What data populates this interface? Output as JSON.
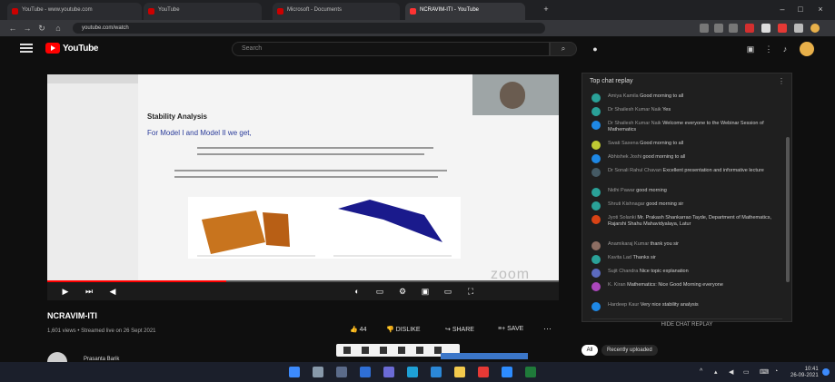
{
  "browser": {
    "tabs": [
      {
        "label": "YouTube - www.youtube.com"
      },
      {
        "label": "YouTube"
      },
      {
        "label": "Microsoft - Documents"
      },
      {
        "label": "NCRAVIM-ITI - YouTube",
        "active": true
      }
    ],
    "url": "youtube.com/watch"
  },
  "youtube": {
    "logo_text": "YouTube",
    "search_placeholder": "Search"
  },
  "video": {
    "slide_title": "Stability Analysis",
    "slide_subtitle": "For Model I and Model II we get,",
    "watermark": "zoom",
    "progress": 0.35,
    "title": "NCRAVIM-ITI",
    "meta": "1,601 views • Streamed live on 26 Sept 2021",
    "likes": "44",
    "dislike_label": "DISLIKE",
    "share_label": "SHARE",
    "save_label": "SAVE",
    "channel_name": "Prasanta Barik"
  },
  "chat": {
    "header": "Top chat replay",
    "messages": [
      {
        "author": "Amiya Kamila",
        "text": "Good morning to all",
        "color": "#2aa198"
      },
      {
        "author": "Dr Shailesh Kumar Naik",
        "text": "Yes",
        "color": "#2aa198"
      },
      {
        "author": "Dr Shailesh Kumar Naik",
        "text": "Welcome everyone to the Webinar Session of Mathematics",
        "color": "#1e88e5"
      },
      {
        "author": "Swati Saxena",
        "text": "Good morning to all",
        "color": "#c0ca33"
      },
      {
        "author": "Abhishek Joshi",
        "text": "good morning to all",
        "color": "#1e88e5"
      },
      {
        "author": "Dr Sonali Rahul Chavan",
        "text": "Excellent presentation and informative lecture",
        "color": "#455a64"
      },
      {
        "author": "Nidhi Pawar",
        "text": "good morning",
        "color": "#2aa198"
      },
      {
        "author": "Shruti Kishnagar",
        "text": "good morning sir",
        "color": "#2aa198"
      },
      {
        "author": "Jyoti Solanki",
        "text": "Mr. Prakash Shankarrao Tayde, Department of Mathematics, Rajarshi Shahu Mahavidyalaya, Latur",
        "color": "#d84315"
      },
      {
        "author": "Anamikaraj Kumar",
        "text": "thank you sir",
        "color": "#8d6e63"
      },
      {
        "author": "Kavita Lad",
        "text": "Thanks sir",
        "color": "#2aa198"
      },
      {
        "author": "Sujit Chandra",
        "text": "Nice topic explanation",
        "color": "#5c6bc0"
      },
      {
        "author": "K. Kiran",
        "text": "Mathematics: Nice Good Morning everyone",
        "color": "#ab47bc"
      },
      {
        "author": "Hardeep Kaur",
        "text": "Very nice stability analysis",
        "color": "#1e88e5"
      }
    ],
    "hide_label": "HIDE CHAT REPLAY"
  },
  "filters": {
    "all_label": "All",
    "recent_label": "Recently uploaded"
  },
  "taskbar": {
    "clock_time": "10:41",
    "clock_date": "26-09-2021"
  }
}
